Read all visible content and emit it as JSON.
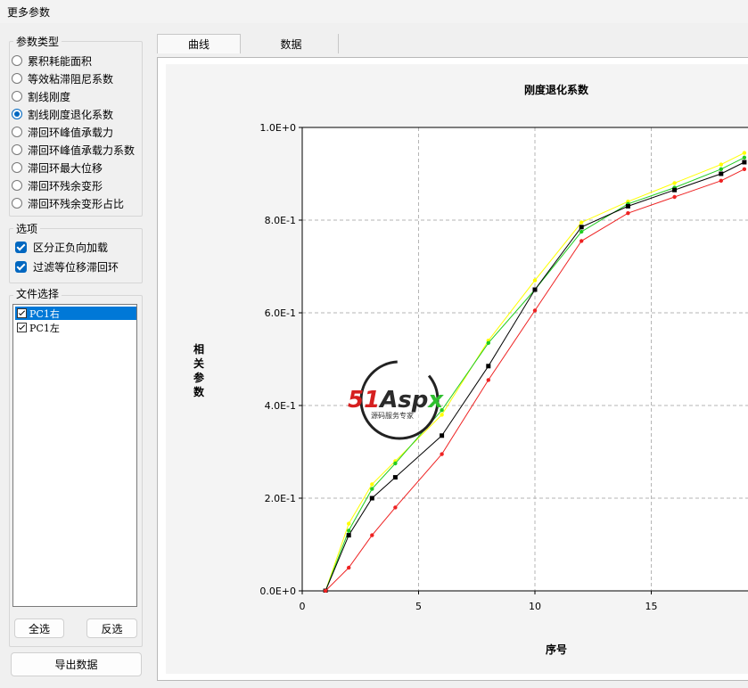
{
  "window": {
    "title": "更多参数"
  },
  "param_type": {
    "label": "参数类型",
    "options": [
      {
        "label": "累积耗能面积",
        "selected": false
      },
      {
        "label": "等效粘滞阻尼系数",
        "selected": false
      },
      {
        "label": "割线刚度",
        "selected": false
      },
      {
        "label": "割线刚度退化系数",
        "selected": true
      },
      {
        "label": "滞回环峰值承载力",
        "selected": false
      },
      {
        "label": "滞回环峰值承载力系数",
        "selected": false
      },
      {
        "label": "滞回环最大位移",
        "selected": false
      },
      {
        "label": "滞回环残余变形",
        "selected": false
      },
      {
        "label": "滞回环残余变形占比",
        "selected": false
      }
    ]
  },
  "options": {
    "label": "选项",
    "items": [
      {
        "label": "区分正负向加载",
        "checked": true
      },
      {
        "label": "过滤等位移滞回环",
        "checked": true
      }
    ]
  },
  "file_select": {
    "label": "文件选择",
    "files": [
      {
        "label": "PC1右",
        "checked": true,
        "selected": true
      },
      {
        "label": "PC1左",
        "checked": true,
        "selected": false
      }
    ],
    "select_all": "全选",
    "invert": "反选"
  },
  "export_button": "导出数据",
  "tabs": [
    {
      "label": "曲线",
      "active": true
    },
    {
      "label": "数据",
      "active": false
    }
  ],
  "watermark": {
    "main": "51Aspx",
    "sub": "源码服务专家"
  },
  "colors": {
    "accent": "#0067c0",
    "selection": "#0078d7"
  },
  "chart_data": {
    "type": "line",
    "title": "刚度退化系数",
    "xlabel": "序号",
    "ylabel": "相关参数",
    "xlim": [
      0,
      19
    ],
    "ylim": [
      0,
      1.0
    ],
    "x_ticks": [
      0,
      5,
      10,
      15
    ],
    "y_ticks": [
      "0.0E+0",
      "2.0E-1",
      "4.0E-1",
      "6.0E-1",
      "8.0E-1",
      "1.0E+0"
    ],
    "y_tick_values": [
      0,
      0.2,
      0.4,
      0.6,
      0.8,
      1.0
    ],
    "grid": true,
    "series": [
      {
        "color": "#ffff00",
        "marker": "circle",
        "x": [
          1,
          2,
          3,
          4,
          6,
          8,
          10,
          12,
          14,
          16,
          18,
          19
        ],
        "y": [
          0.0,
          0.145,
          0.23,
          0.28,
          0.38,
          0.54,
          0.67,
          0.795,
          0.84,
          0.88,
          0.92,
          0.945
        ]
      },
      {
        "color": "#22cc22",
        "marker": "circle",
        "x": [
          1,
          2,
          3,
          4,
          6,
          8,
          10,
          12,
          14,
          16,
          18,
          19
        ],
        "y": [
          0.0,
          0.13,
          0.22,
          0.275,
          0.39,
          0.535,
          0.65,
          0.775,
          0.835,
          0.87,
          0.91,
          0.935
        ]
      },
      {
        "color": "#000000",
        "marker": "square",
        "x": [
          1,
          2,
          3,
          4,
          6,
          8,
          10,
          12,
          14,
          16,
          18,
          19
        ],
        "y": [
          0.0,
          0.12,
          0.2,
          0.245,
          0.335,
          0.485,
          0.65,
          0.785,
          0.83,
          0.865,
          0.9,
          0.925
        ]
      },
      {
        "color": "#ee2222",
        "marker": "circle",
        "x": [
          1,
          2,
          3,
          4,
          6,
          8,
          10,
          12,
          14,
          16,
          18,
          19
        ],
        "y": [
          0.0,
          0.05,
          0.12,
          0.18,
          0.295,
          0.455,
          0.605,
          0.755,
          0.815,
          0.85,
          0.885,
          0.91
        ]
      }
    ]
  }
}
